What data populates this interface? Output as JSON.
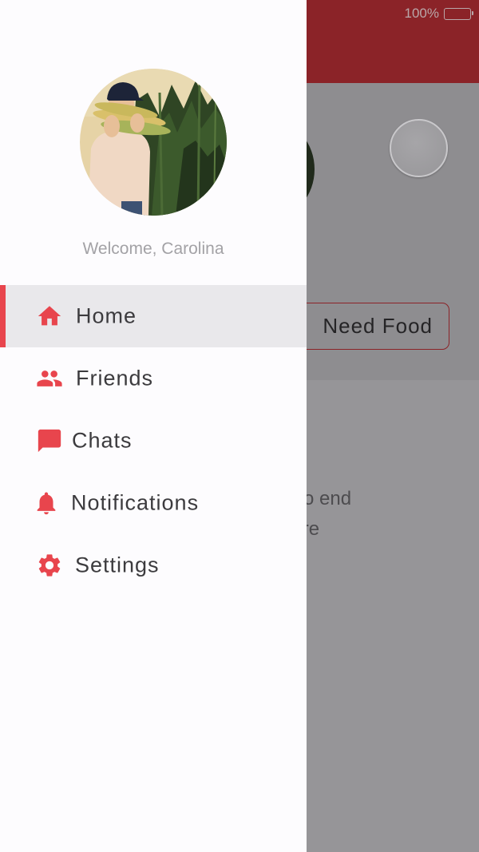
{
  "status_bar": {
    "battery": "100%"
  },
  "background": {
    "need_food_button": "Need Food",
    "text_line_1": "od to end",
    "text_line_2": "share"
  },
  "drawer": {
    "welcome": "Welcome, Carolina",
    "nav_items": [
      {
        "label": "Home",
        "icon": "home-icon",
        "active": true
      },
      {
        "label": "Friends",
        "icon": "people-icon",
        "active": false
      },
      {
        "label": "Chats",
        "icon": "chat-bubble-icon",
        "active": false
      },
      {
        "label": "Notifications",
        "icon": "bell-icon",
        "active": false
      },
      {
        "label": "Settings",
        "icon": "gear-icon",
        "active": false
      }
    ]
  },
  "colors": {
    "accent": "#e8454d",
    "header": "#8b2328",
    "drawer_bg": "#fdfcfe",
    "active_row": "#e9e8eb"
  }
}
